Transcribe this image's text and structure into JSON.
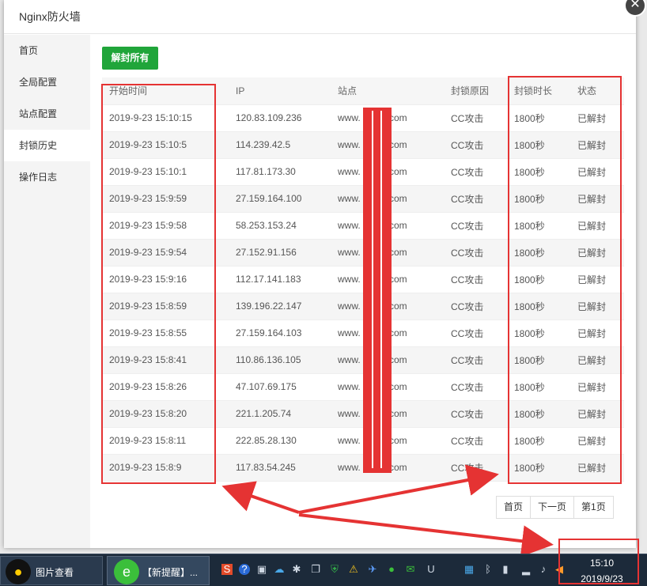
{
  "window": {
    "title": "Nginx防火墙",
    "close_symbol": "✕"
  },
  "sidebar": {
    "items": [
      {
        "label": "首页",
        "active": false
      },
      {
        "label": "全局配置",
        "active": false
      },
      {
        "label": "站点配置",
        "active": false
      },
      {
        "label": "封锁历史",
        "active": true
      },
      {
        "label": "操作日志",
        "active": false
      }
    ]
  },
  "main": {
    "unblock_all_label": "解封所有",
    "columns": [
      "开始时间",
      "IP",
      "站点",
      "封锁原因",
      "封锁时长",
      "状态"
    ],
    "rows": [
      [
        "2019-9-23 15:10:15",
        "120.83.109.236",
        "www.",
        ".com",
        "CC攻击",
        "1800秒",
        "已解封"
      ],
      [
        "2019-9-23 15:10:5",
        "114.239.42.5",
        "www.",
        ".com",
        "CC攻击",
        "1800秒",
        "已解封"
      ],
      [
        "2019-9-23 15:10:1",
        "117.81.173.30",
        "www.",
        ".com",
        "CC攻击",
        "1800秒",
        "已解封"
      ],
      [
        "2019-9-23 15:9:59",
        "27.159.164.100",
        "www.",
        ".com",
        "CC攻击",
        "1800秒",
        "已解封"
      ],
      [
        "2019-9-23 15:9:58",
        "58.253.153.24",
        "www.",
        ".com",
        "CC攻击",
        "1800秒",
        "已解封"
      ],
      [
        "2019-9-23 15:9:54",
        "27.152.91.156",
        "www.",
        ".com",
        "CC攻击",
        "1800秒",
        "已解封"
      ],
      [
        "2019-9-23 15:9:16",
        "112.17.141.183",
        "www.",
        ".com",
        "CC攻击",
        "1800秒",
        "已解封"
      ],
      [
        "2019-9-23 15:8:59",
        "139.196.22.147",
        "www.",
        ".com",
        "CC攻击",
        "1800秒",
        "已解封"
      ],
      [
        "2019-9-23 15:8:55",
        "27.159.164.103",
        "www.",
        ".com",
        "CC攻击",
        "1800秒",
        "已解封"
      ],
      [
        "2019-9-23 15:8:41",
        "110.86.136.105",
        "www.",
        ".com",
        "CC攻击",
        "1800秒",
        "已解封"
      ],
      [
        "2019-9-23 15:8:26",
        "47.107.69.175",
        "www.",
        ".com",
        "CC攻击",
        "1800秒",
        "已解封"
      ],
      [
        "2019-9-23 15:8:20",
        "221.1.205.74",
        "www.",
        ".com",
        "CC攻击",
        "1800秒",
        "已解封"
      ],
      [
        "2019-9-23 15:8:11",
        "222.85.28.130",
        "www.",
        ".com",
        "CC攻击",
        "1800秒",
        "已解封"
      ],
      [
        "2019-9-23 15:8:9",
        "117.83.54.245",
        "www.",
        ".com",
        "CC攻击",
        "1800秒",
        "已解封"
      ]
    ],
    "pagination": {
      "first": "首页",
      "next": "下一页",
      "current": "第1页"
    }
  },
  "taskbar": {
    "start_label": "图片查看",
    "task_label": "【新提醒】...",
    "time": "15:10",
    "date": "2019/9/23"
  },
  "colors": {
    "accent": "#20a53a",
    "annotation": "#e53333"
  }
}
